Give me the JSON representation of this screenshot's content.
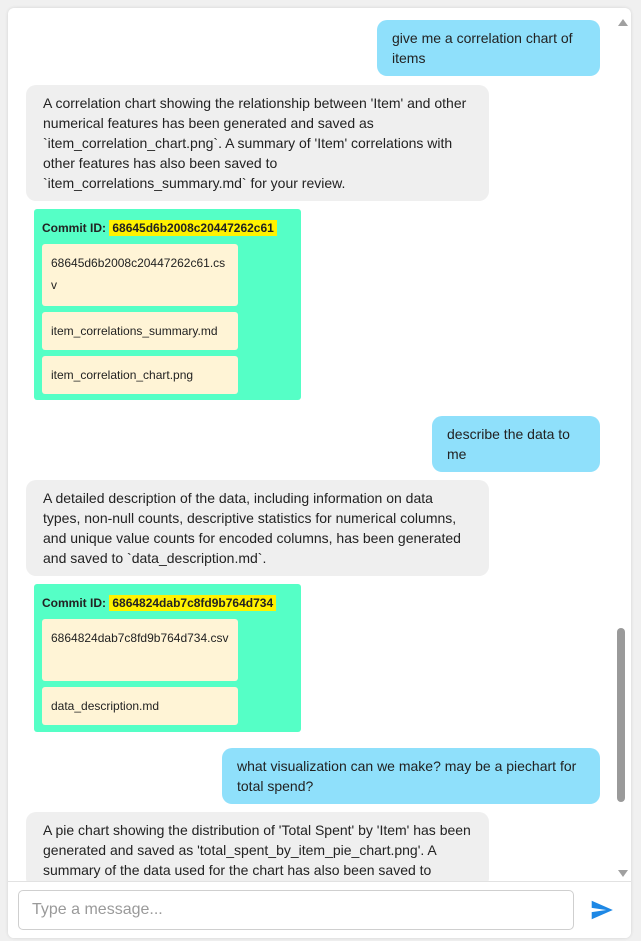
{
  "messages": {
    "m1": "give me a correlation chart of items",
    "m2": "A correlation chart showing the relationship between 'Item' and other numerical features has been generated and saved as `item_correlation_chart.png`. A summary of 'Item' correlations with other features has also been saved to `item_correlations_summary.md` for your review.",
    "m3": "describe the data to me",
    "m4": "A detailed description of the data, including information on data types, non-null counts, descriptive statistics for numerical columns, and unique value counts for encoded columns, has been generated and saved to `data_description.md`.",
    "m5": "what visualization can we make? may be a piechart for total spend?",
    "m6": "A pie chart showing the distribution of 'Total Spent' by 'Item' has been generated and saved as 'total_spent_by_item_pie_chart.png'. A summary of the data used for the chart has also been saved to"
  },
  "commits": {
    "c1": {
      "label": "Commit ID:",
      "id": "68645d6b2008c20447262c61",
      "files": [
        "68645d6b2008c20447262c61.csv",
        "item_correlations_summary.md",
        "item_correlation_chart.png"
      ]
    },
    "c2": {
      "label": "Commit ID:",
      "id": "6864824dab7c8fd9b764d734",
      "files": [
        "6864824dab7c8fd9b764d734.csv",
        "data_description.md"
      ]
    }
  },
  "input": {
    "placeholder": "Type a message..."
  },
  "icons": {
    "send": "send-icon",
    "scroll_up": "scroll-up-arrow",
    "scroll_down": "scroll-down-arrow"
  },
  "colors": {
    "user_bubble": "#8fe0fb",
    "bot_bubble": "#efefef",
    "commit_bg": "#55ffc6",
    "commit_id_highlight": "#fff200",
    "file_bg": "#fff4d6",
    "send": "#1e88e5"
  }
}
